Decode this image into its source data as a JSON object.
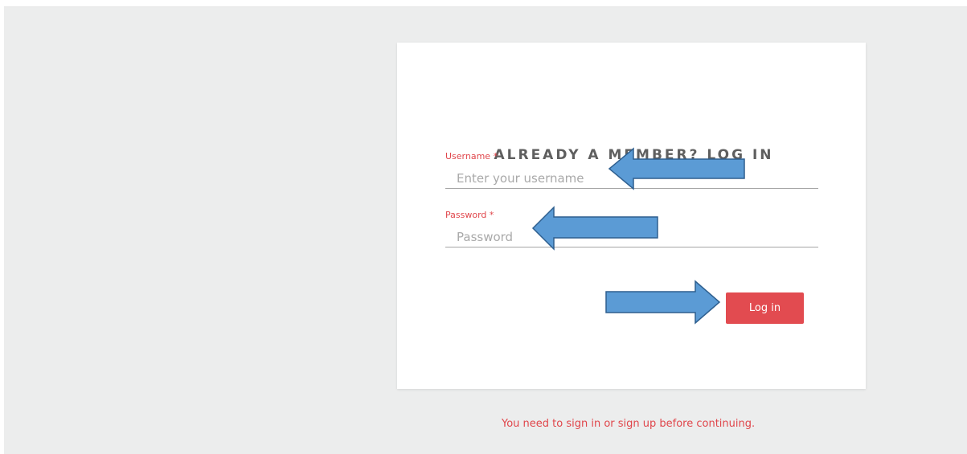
{
  "login_card": {
    "title": "ALREADY A MEMBER? LOG IN",
    "username": {
      "label": "Username *",
      "placeholder": "Enter your username",
      "value": ""
    },
    "password": {
      "label": "Password *",
      "placeholder": "Password",
      "value": ""
    },
    "submit_label": "Log in"
  },
  "notice": "You need to sign in or sign up before continuing.",
  "colors": {
    "background": "#eceded",
    "card": "#ffffff",
    "accent_red": "#e24b50",
    "label_red": "#e0464b",
    "annotation_arrow_fill": "#5b9bd5",
    "annotation_arrow_stroke": "#2e5f8f"
  },
  "annotations": {
    "arrow_icon": "left-arrow-icon / right-arrow-icon"
  }
}
